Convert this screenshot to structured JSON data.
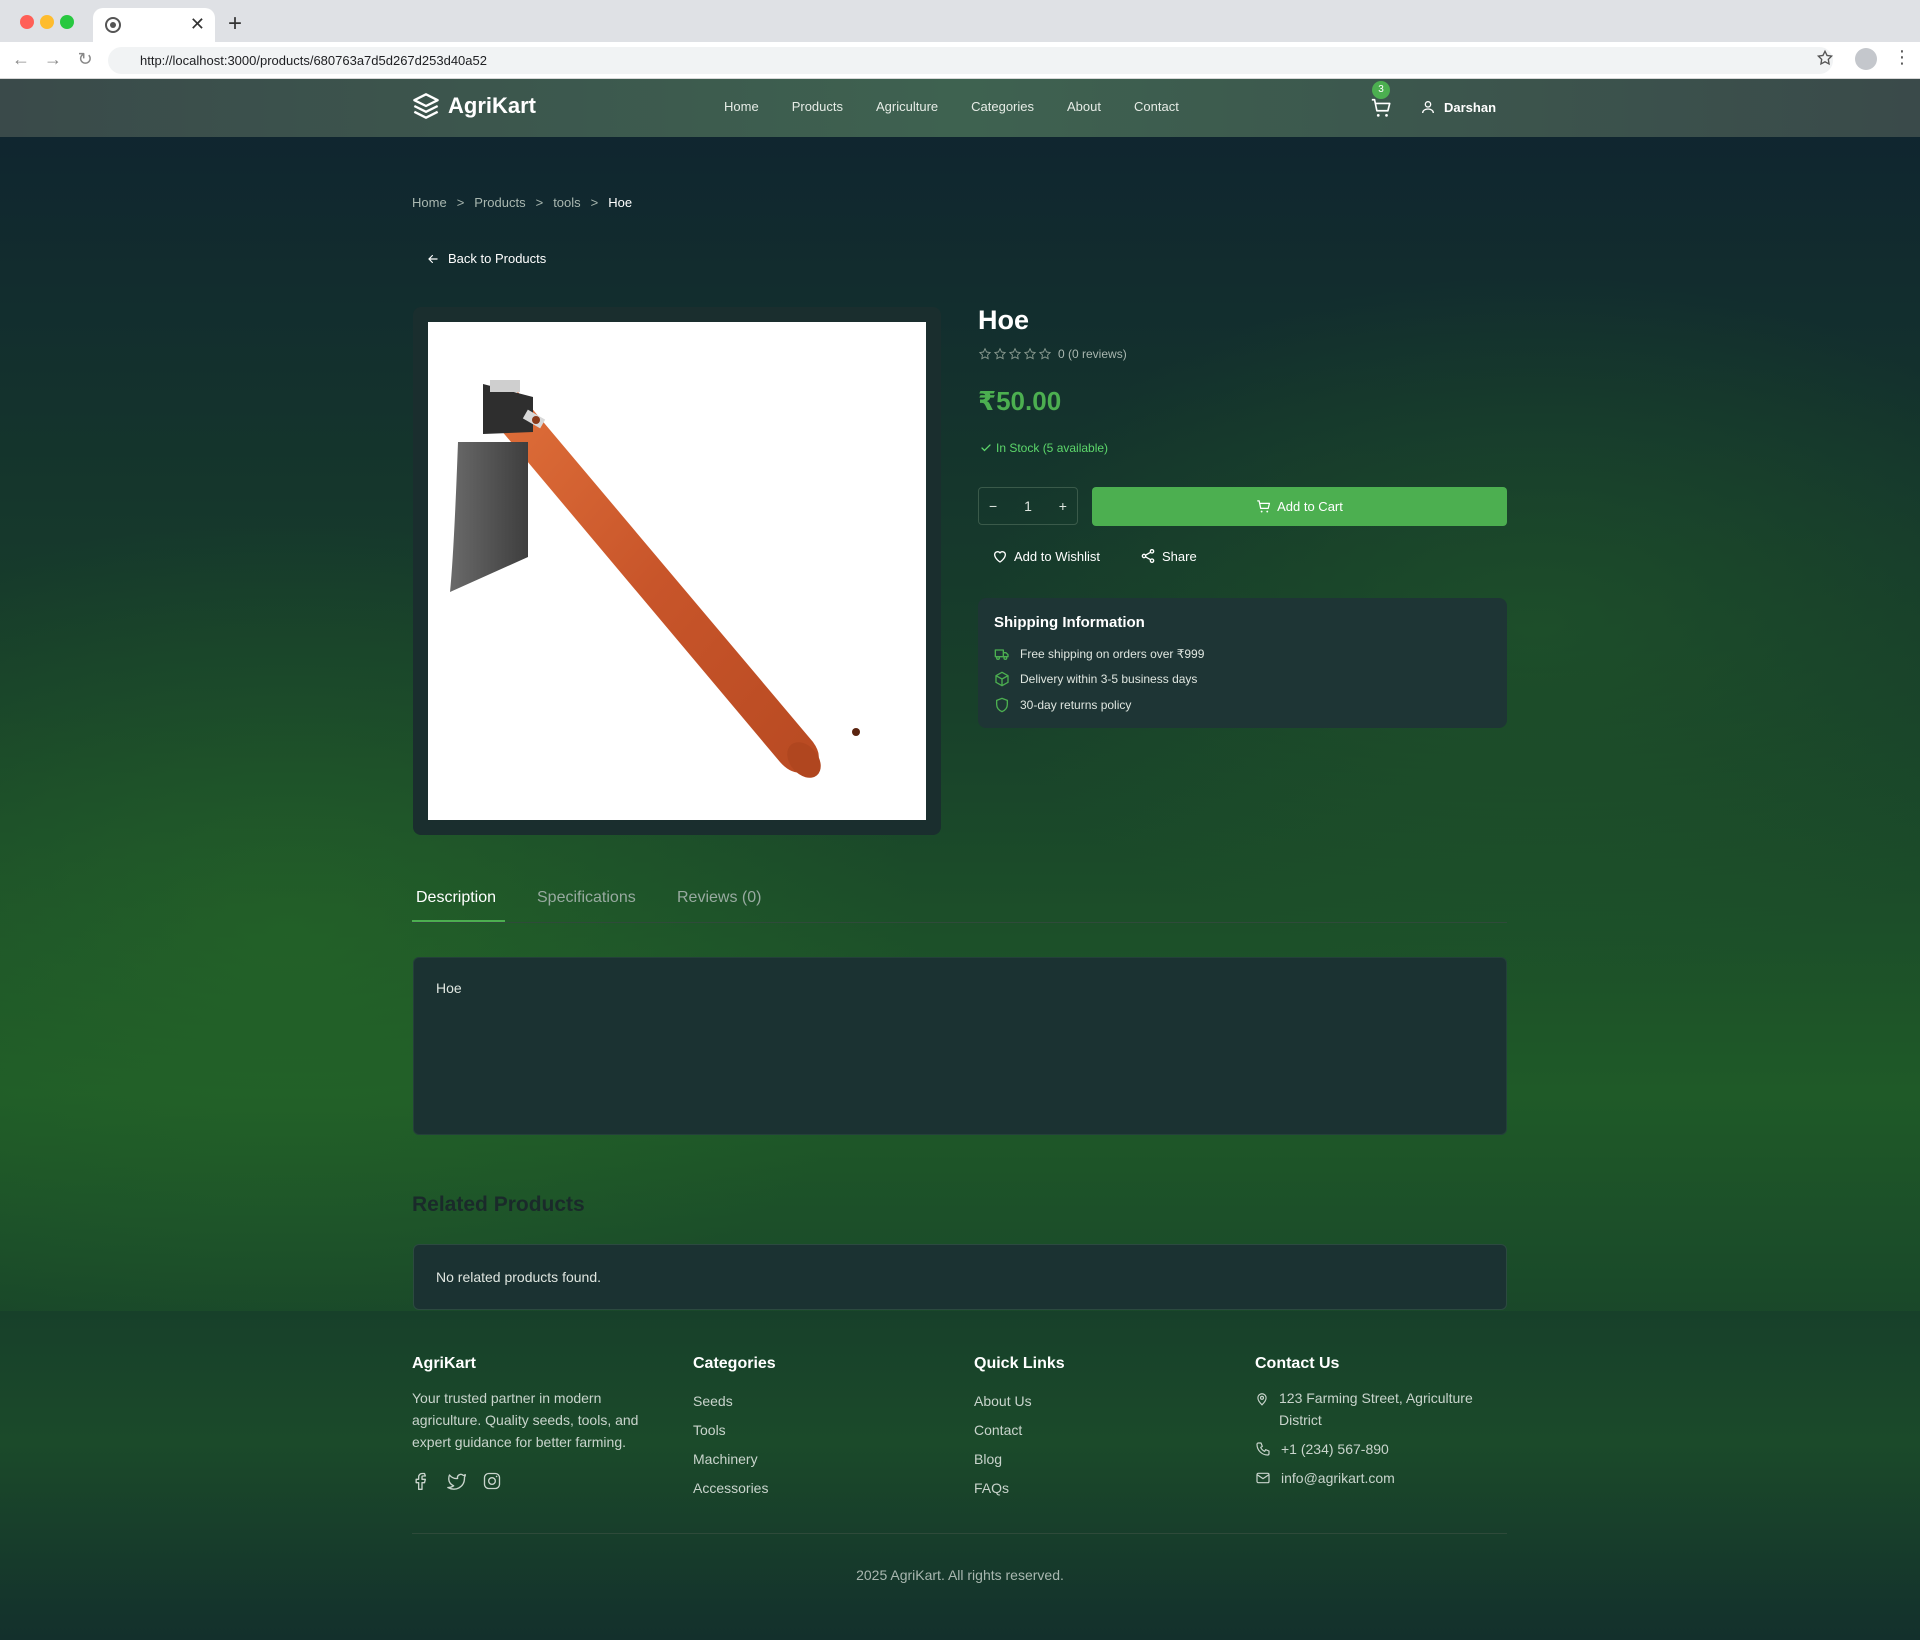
{
  "browser": {
    "url": "http://localhost:3000/products/680763a7d5d267d253d40a52",
    "new_tab": "+",
    "tab_close": "✕"
  },
  "header": {
    "logo_text": "AgriKart",
    "nav": [
      "Home",
      "Products",
      "Agriculture",
      "Categories",
      "About",
      "Contact"
    ],
    "cart_count": "3",
    "user_name": "Darshan"
  },
  "breadcrumb": {
    "items": [
      "Home",
      "Products",
      "tools",
      "Hoe"
    ],
    "separator": ">"
  },
  "back_link": "Back to Products",
  "product": {
    "title": "Hoe",
    "rating_value": 0,
    "rating_text": "0 (0 reviews)",
    "price": "₹50.00",
    "stock": "In Stock (5 available)",
    "quantity": "1",
    "qty_minus": "−",
    "qty_plus": "+",
    "add_to_cart": "Add to Cart",
    "wishlist": "Add to Wishlist",
    "share": "Share"
  },
  "shipping": {
    "title": "Shipping Information",
    "items": [
      {
        "icon": "truck-icon",
        "text": "Free shipping on orders over ₹999"
      },
      {
        "icon": "package-icon",
        "text": "Delivery within 3-5 business days"
      },
      {
        "icon": "shield-icon",
        "text": "30-day returns policy"
      }
    ]
  },
  "tabs": {
    "items": [
      "Description",
      "Specifications",
      "Reviews (0)"
    ],
    "active": "Description"
  },
  "description": "Hoe",
  "related": {
    "title": "Related Products",
    "empty_text": "No related products found."
  },
  "footer": {
    "brand": {
      "title": "AgriKart",
      "text": "Your trusted partner in modern agriculture. Quality seeds, tools, and expert guidance for better farming.",
      "social": [
        "facebook-icon",
        "twitter-icon",
        "instagram-icon"
      ]
    },
    "categories": {
      "title": "Categories",
      "links": [
        "Seeds",
        "Tools",
        "Machinery",
        "Accessories"
      ]
    },
    "quick_links": {
      "title": "Quick Links",
      "links": [
        "About Us",
        "Contact",
        "Blog",
        "FAQs"
      ]
    },
    "contact": {
      "title": "Contact Us",
      "address": "123 Farming Street, Agriculture District",
      "phone": "+1 (234) 567-890",
      "email": "info@agrikart.com"
    },
    "copyright": "2025 AgriKart. All rights reserved."
  },
  "colors": {
    "accent": "#4caf50",
    "header_bg": "#3e6250",
    "panel_bg": "#1b3232"
  }
}
